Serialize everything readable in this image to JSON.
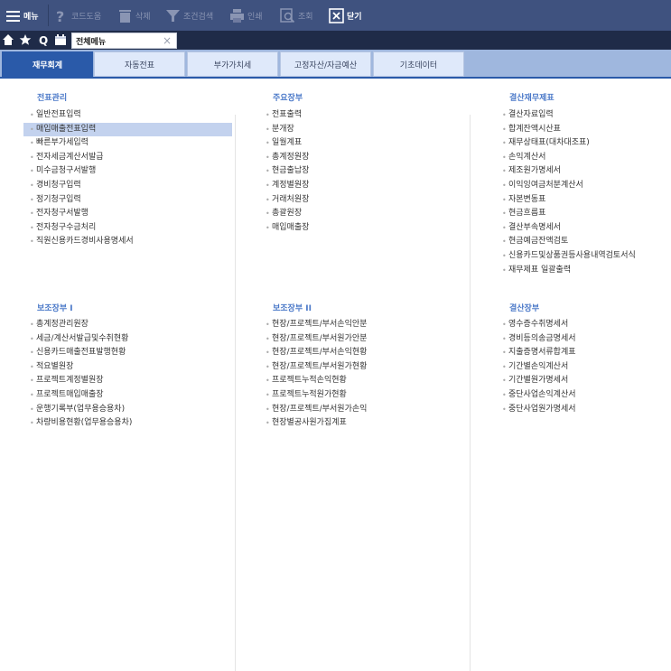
{
  "toolbar": {
    "menu": "메뉴",
    "code_help": "코드도움",
    "delete": "삭제",
    "filter": "조건검색",
    "print": "인쇄",
    "search": "조회",
    "close": "닫기"
  },
  "tabrow": {
    "open_tab": "전체메뉴",
    "close_symbol": "×"
  },
  "categories": [
    "재무회계",
    "자동전표",
    "부가가치세",
    "고정자산/자금예산",
    "기초데이터"
  ],
  "columns": {
    "col1": {
      "sec1": {
        "title": "전표관리",
        "items": [
          "일반전표입력",
          "매입매출전표입력",
          "빠른부가세입력",
          "전자세금계산서발급",
          "미수금청구서발행",
          "경비청구입력",
          "정기청구입력",
          "전자청구서발행",
          "전자청구수금처리",
          "직원신용카드경비사용명세서"
        ]
      },
      "sec2": {
        "title": "보조장부 I",
        "items": [
          "총계정관리원장",
          "세금/계산서발급및수취현황",
          "신용카드매출전표발행현황",
          "적요별원장",
          "프로젝트계정별원장",
          "프로젝트매입매출장",
          "운행기록부(업무용승용차)",
          "차량비용현황(업무용승용차)"
        ]
      }
    },
    "col2": {
      "sec1": {
        "title": "주요장부",
        "items": [
          "전표출력",
          "분개장",
          "일월계표",
          "총계정원장",
          "현금출납장",
          "계정별원장",
          "거래처원장",
          "총괄원장",
          "매입매출장"
        ]
      },
      "sec2": {
        "title": "보조장부 II",
        "items": [
          "현장/프로젝트/부서손익안분",
          "현장/프로젝트/부서원가안분",
          "현장/프로젝트/부서손익현황",
          "현장/프로젝트/부서원가현황",
          "프로젝트누적손익현황",
          "프로젝트누적원가현황",
          "현장/프로젝트/부서원가손익",
          "현장별공사원가집계표"
        ]
      }
    },
    "col3": {
      "sec1": {
        "title": "결산재무제표",
        "items": [
          "결산자료입력",
          "합계잔액시산표",
          "재무상태표(대차대조표)",
          "손익계산서",
          "제조원가명세서",
          "이익잉여금처분계산서",
          "자본변동표",
          "현금흐름표",
          "결산부속명세서",
          "현금예금잔액검토",
          "신용카드및상품권등사용내역검토서식",
          "재무제표 일괄출력"
        ]
      },
      "sec2": {
        "title": "결산장부",
        "items": [
          "영수증수취명세서",
          "경비등의송금명세서",
          "지출증명서류합계표",
          "기간별손익계산서",
          "기간별원가명세서",
          "중단사업손익계산서",
          "중단사업원가명세서"
        ]
      }
    }
  },
  "colors": {
    "toolbar_bg": "#3f527f",
    "accent": "#2a5aa9",
    "section_title": "#4a78c8",
    "selected_row": "#c3d2ee"
  },
  "icons": [
    "hamburger-icon",
    "question-icon",
    "trash-icon",
    "filter-icon",
    "printer-icon",
    "search-icon",
    "close-box-icon",
    "home-icon",
    "star-icon",
    "q-icon",
    "calendar-icon"
  ]
}
